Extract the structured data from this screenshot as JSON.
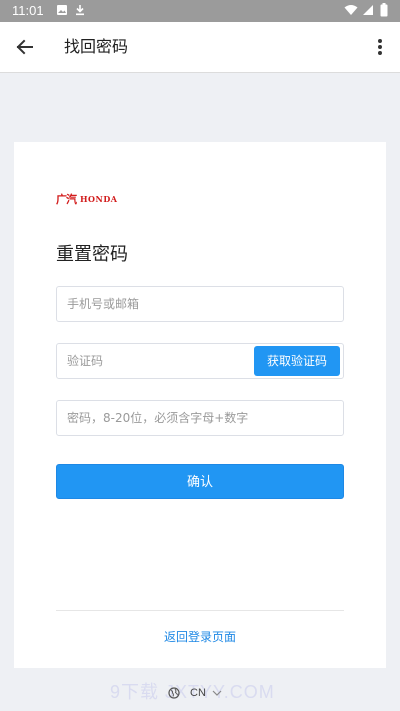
{
  "status_bar": {
    "time": "11:01",
    "left_icons": [
      "image-icon",
      "download-icon"
    ],
    "right_icons": [
      "wifi-icon",
      "signal-icon",
      "battery-icon"
    ]
  },
  "app_bar": {
    "back_icon": "arrow-left-icon",
    "title": "找回密码",
    "menu_icon": "more-vertical-icon"
  },
  "card": {
    "logo": {
      "cn": "广汽",
      "en": "HONDA",
      "color": "#d21c1c"
    },
    "heading": "重置密码",
    "phone_email_placeholder": "手机号或邮箱",
    "code_placeholder": "验证码",
    "get_code_button": "获取验证码",
    "password_placeholder": "密码，8-20位，必须含字母+数字",
    "confirm_button": "确认",
    "back_to_login": "返回登录页面"
  },
  "footer": {
    "language_icon": "globe-icon",
    "language": "CN",
    "dropdown_icon": "chevron-down-icon",
    "watermark": "9下载 JXTYY.COM"
  },
  "colors": {
    "accent": "#2196f3",
    "link": "#1e88e5",
    "background": "#eef0f4",
    "status_bar": "#9b9b9b"
  }
}
